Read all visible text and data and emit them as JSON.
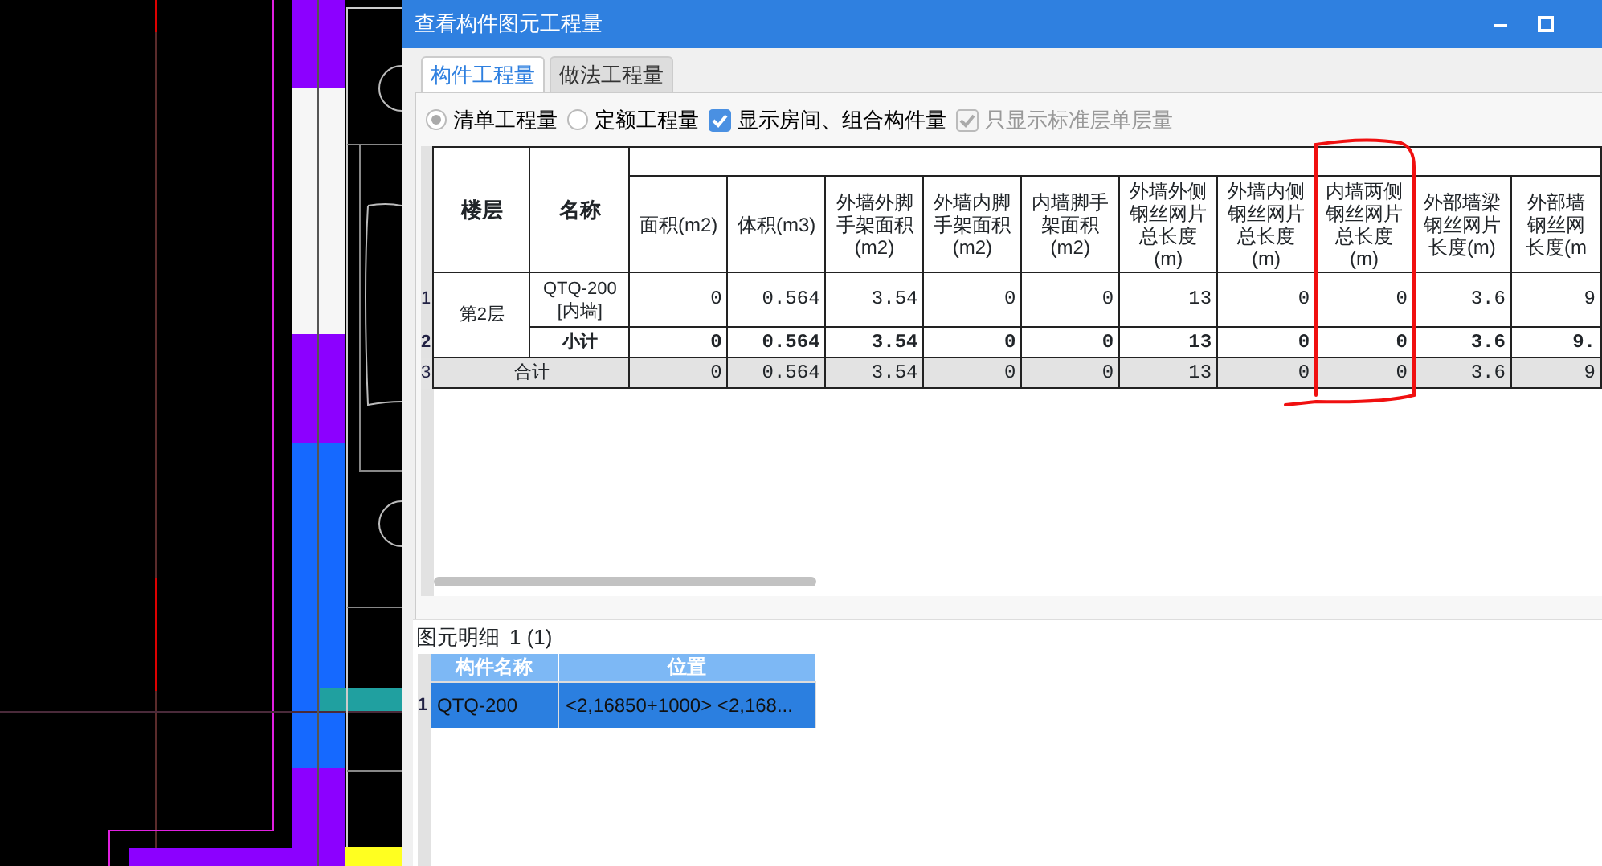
{
  "window": {
    "title": "查看构件图元工程量"
  },
  "tabs": [
    {
      "label": "构件工程量",
      "selected": true
    },
    {
      "label": "做法工程量",
      "selected": false
    }
  ],
  "options": [
    {
      "kind": "radio",
      "label": "清单工程量",
      "selected": true
    },
    {
      "kind": "radio",
      "label": "定额工程量",
      "selected": false
    },
    {
      "kind": "checkbox",
      "label": "显示房间、组合构件量",
      "checked": true,
      "disabled": false
    },
    {
      "kind": "checkbox",
      "label": "只显示标准层单层量",
      "checked": true,
      "disabled": true
    }
  ],
  "table": {
    "columns": [
      "楼层",
      "名称",
      "面积(m2)",
      "体积(m3)",
      "外墙外脚手架面积(m2)",
      "外墙内脚手架面积(m2)",
      "内墙脚手架面积(m2)",
      "外墙外侧钢丝网片总长度(m)",
      "外墙内侧钢丝网片总长度(m)",
      "内墙两侧钢丝网片总长度(m)",
      "外部墙梁钢丝网片长度(m)",
      "外部墙钢丝网长度(m"
    ],
    "rows": [
      {
        "row_number": "1",
        "kind": "item",
        "floor": "第2层",
        "name": "QTQ-200 [内墙]",
        "values": [
          "0",
          "0.564",
          "3.54",
          "0",
          "0",
          "13",
          "0",
          "0",
          "3.6",
          "9"
        ]
      },
      {
        "row_number": "2",
        "kind": "subtotal",
        "name": "小计",
        "values": [
          "0",
          "0.564",
          "3.54",
          "0",
          "0",
          "13",
          "0",
          "0",
          "3.6",
          "9."
        ]
      },
      {
        "row_number": "3",
        "kind": "total",
        "name": "合计",
        "values": [
          "0",
          "0.564",
          "3.54",
          "0",
          "0",
          "13",
          "0",
          "0",
          "3.6",
          "9"
        ]
      }
    ]
  },
  "detail": {
    "title": "图元明细",
    "count": "1 (1)",
    "columns": [
      "构件名称",
      "位置"
    ],
    "rows": [
      {
        "row_number": "1",
        "selected": true,
        "cells": [
          "QTQ-200",
          "<2,16850+1000> <2,168..."
        ]
      }
    ]
  }
}
